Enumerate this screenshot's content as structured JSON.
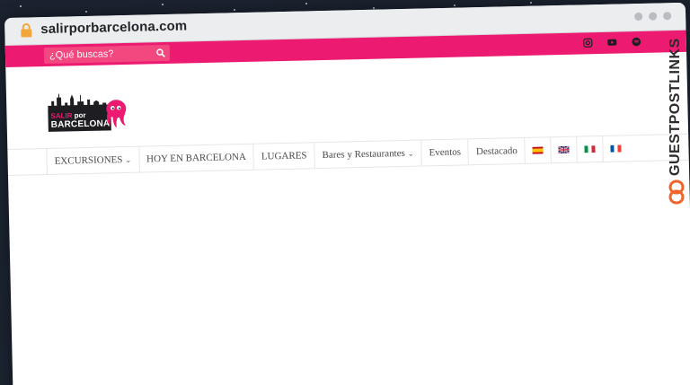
{
  "browser": {
    "url": "salirporbarcelona.com"
  },
  "topbar": {
    "search_placeholder": "¿Qué buscas?",
    "social_icons": [
      "instagram-icon",
      "youtube-icon",
      "spotify-icon"
    ]
  },
  "logo": {
    "line1_a": "SALIR",
    "line1_b": "por",
    "line2": "BARCELONA"
  },
  "nav": {
    "items": [
      {
        "label": "EXCURSIONES",
        "has_dropdown": true
      },
      {
        "label": "HOY EN BARCELONA",
        "has_dropdown": false
      },
      {
        "label": "LUGARES",
        "has_dropdown": false
      },
      {
        "label": "Bares y Restaurantes",
        "has_dropdown": true
      },
      {
        "label": "Eventos",
        "has_dropdown": false
      },
      {
        "label": "Destacado",
        "has_dropdown": false
      }
    ],
    "chevron": "⌄",
    "flags": [
      "spanish-flag-icon",
      "uk-flag-icon",
      "italian-flag-icon",
      "french-flag-icon"
    ]
  },
  "watermark": {
    "text": "GUESTPOSTLINKS"
  },
  "colors": {
    "brand_pink": "#ed1a71",
    "search_bg": "#f3487f",
    "page_bg": "#1b2330"
  }
}
